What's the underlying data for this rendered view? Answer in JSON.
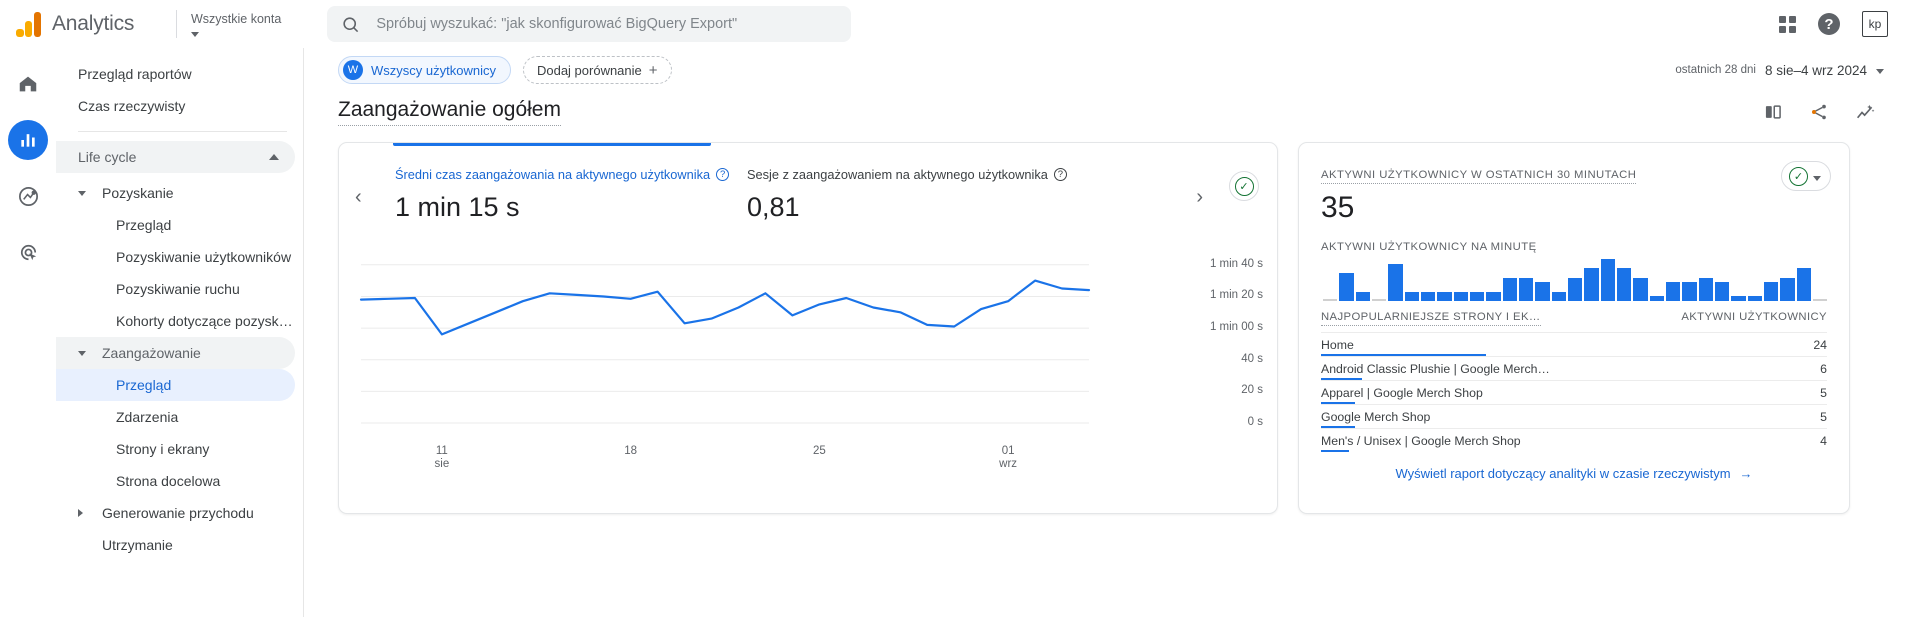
{
  "header": {
    "app_title": "Analytics",
    "logo_icon": "google-analytics-logo",
    "account_selector_label": "Wszystkie konta",
    "search_placeholder": "Spróbuj wyszukać: \"jak skonfigurować BigQuery Export\"",
    "search_icon": "search-icon",
    "apps_icon": "apps-grid-icon",
    "help_icon": "help-icon",
    "help_glyph": "?",
    "avatar_initials": "kp"
  },
  "rail": [
    {
      "name": "home",
      "icon": "home-icon",
      "active": false
    },
    {
      "name": "reports",
      "icon": "bar-chart-icon",
      "active": true
    },
    {
      "name": "explore",
      "icon": "explore-compass-icon",
      "active": false
    },
    {
      "name": "advertising",
      "icon": "advertising-target-icon",
      "active": false
    }
  ],
  "sidebar": {
    "items": [
      {
        "label": "Przegląd raportów",
        "level": 0,
        "type": "link"
      },
      {
        "label": "Czas rzeczywisty",
        "level": 0,
        "type": "link"
      },
      {
        "label": "Life cycle",
        "level": 0,
        "type": "group",
        "expanded": true
      },
      {
        "label": "Pozyskanie",
        "level": 1,
        "type": "section",
        "expanded": true
      },
      {
        "label": "Przegląd",
        "level": 2,
        "type": "link"
      },
      {
        "label": "Pozyskiwanie użytkowników",
        "level": 2,
        "type": "link"
      },
      {
        "label": "Pozyskiwanie ruchu",
        "level": 2,
        "type": "link"
      },
      {
        "label": "Kohorty dotyczące pozysk…",
        "level": 2,
        "type": "link"
      },
      {
        "label": "Zaangażowanie",
        "level": 1,
        "type": "section",
        "expanded": true
      },
      {
        "label": "Przegląd",
        "level": 2,
        "type": "link",
        "selected": true
      },
      {
        "label": "Zdarzenia",
        "level": 2,
        "type": "link"
      },
      {
        "label": "Strony i ekrany",
        "level": 2,
        "type": "link"
      },
      {
        "label": "Strona docelowa",
        "level": 2,
        "type": "link"
      },
      {
        "label": "Generowanie przychodu",
        "level": 1,
        "type": "section",
        "expanded": false
      },
      {
        "label": "Utrzymanie",
        "level": 1,
        "type": "link"
      }
    ]
  },
  "controls": {
    "segment_chip": {
      "avatar_letter": "W",
      "label": "Wszyscy użytkownicy"
    },
    "add_comparison": {
      "label": "Dodaj porównanie",
      "icon": "plus-icon"
    },
    "date_range": {
      "preset": "ostatnich 28 dni",
      "range": "8 sie–4 wrz 2024",
      "icon": "chevron-down-icon"
    }
  },
  "page": {
    "title": "Zaangażowanie ogółem",
    "actions": [
      {
        "name": "compare-icon",
        "label": "compare"
      },
      {
        "name": "share-icon",
        "label": "share"
      },
      {
        "name": "insights-icon",
        "label": "insights"
      }
    ]
  },
  "overview_card": {
    "nav_prev_icon": "chevron-left-icon",
    "nav_next_icon": "chevron-right-icon",
    "status_icon": "check-circle-icon",
    "metrics": [
      {
        "label": "Średni czas zaangażowania na aktywnego użytkownika",
        "value": "1 min 15 s",
        "help_icon": "help-circle-icon",
        "active": true
      },
      {
        "label": "Sesje z zaangażowaniem na aktywnego użytkownika",
        "value": "0,81",
        "help_icon": "help-circle-icon",
        "active": false
      }
    ]
  },
  "realtime_card": {
    "label": "AKTYWNI UŻYTKOWNICY W OSTATNICH 30 MINUTACH",
    "value": "35",
    "status_icon": "check-circle-icon",
    "status_caret": "chevron-down-icon",
    "per_minute_label": "AKTYWNI UŻYTKOWNICY NA MINUTĘ",
    "table": {
      "col_page": "NAJPOPULARNIEJSZE STRONY I EK…",
      "col_users": "AKTYWNI UŻYTKOWNICY",
      "rows": [
        {
          "page": "Home",
          "users": "24"
        },
        {
          "page": "Android Classic Plushie | Google Merch…",
          "users": "6"
        },
        {
          "page": "Apparel | Google Merch Shop",
          "users": "5"
        },
        {
          "page": "Google Merch Shop",
          "users": "5"
        },
        {
          "page": "Men's / Unisex | Google Merch Shop",
          "users": "4"
        }
      ]
    },
    "footer_link": {
      "label": "Wyświetl raport dotyczący analityki w czasie rzeczywistym",
      "icon": "arrow-right-icon"
    }
  },
  "chart_data": {
    "type": "line",
    "title": "Średni czas zaangażowania na aktywnego użytkownika",
    "xlabel": "",
    "ylabel": "",
    "grid": true,
    "legend": false,
    "line_color": "#1a73e8",
    "ylim": [
      0,
      110
    ],
    "ytick_values": [
      100,
      80,
      60,
      40,
      20,
      0
    ],
    "ytick_labels": [
      "1 min 40 s",
      "1 min 20 s",
      "1 min 00 s",
      "40 s",
      "20 s",
      "0 s"
    ],
    "xtick_positions": [
      3,
      10,
      17,
      24
    ],
    "xtick_labels": [
      [
        "11",
        "sie"
      ],
      [
        "18",
        ""
      ],
      [
        "25",
        ""
      ],
      [
        "01",
        "wrz"
      ]
    ],
    "x": [
      "8 sie",
      "9 sie",
      "10 sie",
      "11 sie",
      "12 sie",
      "13 sie",
      "14 sie",
      "15 sie",
      "16 sie",
      "17 sie",
      "18 sie",
      "19 sie",
      "20 sie",
      "21 sie",
      "22 sie",
      "23 sie",
      "24 sie",
      "25 sie",
      "26 sie",
      "27 sie",
      "28 sie",
      "29 sie",
      "30 sie",
      "31 sie",
      "1 wrz",
      "2 wrz",
      "3 wrz",
      "4 wrz"
    ],
    "values": [
      78,
      78.5,
      79,
      56,
      63,
      70,
      77,
      82,
      81,
      80,
      78.5,
      83,
      63,
      66,
      73,
      82,
      68,
      75,
      79,
      73,
      70,
      62,
      61,
      72,
      77,
      90,
      85,
      84
    ],
    "units": "seconds"
  },
  "realtime_bars": {
    "type": "bar",
    "title": "AKTYWNI UŻYTKOWNICY NA MINUTĘ",
    "color": "#1a73e8",
    "values": [
      0,
      6,
      2,
      0,
      8,
      2,
      2,
      2,
      2,
      2,
      2,
      5,
      5,
      4,
      2,
      5,
      7,
      9,
      7,
      5,
      1,
      4,
      4,
      5,
      4,
      1,
      1,
      4,
      5,
      7,
      0
    ]
  }
}
